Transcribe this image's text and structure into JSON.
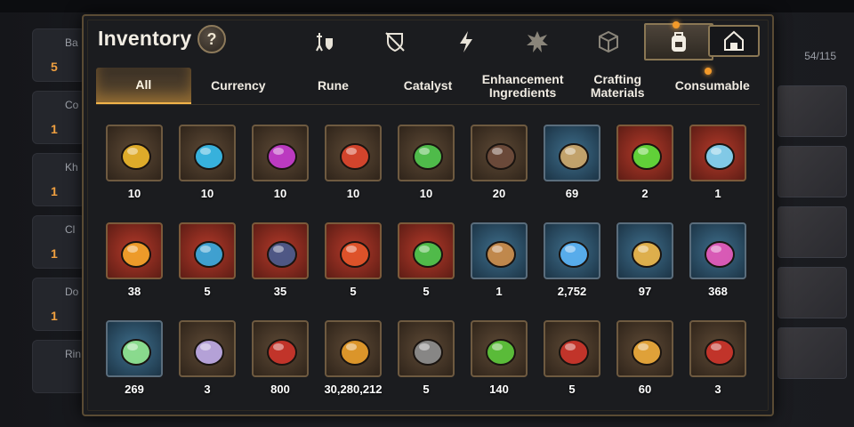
{
  "header": {
    "title": "Inventory",
    "help_label": "?"
  },
  "background": {
    "counter": "54/115",
    "rows": [
      {
        "label": "Ba",
        "num": "5"
      },
      {
        "label": "Co",
        "num": "1"
      },
      {
        "label": "Kh",
        "num": "1"
      },
      {
        "label": "Cl",
        "num": "1"
      },
      {
        "label": "Do",
        "num": "1"
      },
      {
        "label": "Rin",
        "num": ""
      }
    ]
  },
  "category_tabs": [
    {
      "icon": "knight-shield-icon"
    },
    {
      "icon": "broken-shield-icon"
    },
    {
      "icon": "lightning-icon"
    },
    {
      "icon": "burst-icon"
    },
    {
      "icon": "cube-icon"
    },
    {
      "icon": "backpack-icon",
      "active": true
    }
  ],
  "filter_tabs": [
    {
      "label": "All",
      "active": true
    },
    {
      "label": "Currency"
    },
    {
      "label": "Rune"
    },
    {
      "label": "Catalyst"
    },
    {
      "label": "Enhancement Ingredients"
    },
    {
      "label": "Crafting Materials"
    },
    {
      "label": "Consumable"
    }
  ],
  "items": [
    {
      "icon": "yellow-rune-icon",
      "count": "10",
      "color": "#e6b12a",
      "bg": "brown"
    },
    {
      "icon": "blue-rune-icon",
      "count": "10",
      "color": "#36b7e6",
      "bg": "brown"
    },
    {
      "icon": "purple-rune-icon",
      "count": "10",
      "color": "#c13ac8",
      "bg": "brown"
    },
    {
      "icon": "red-rune-icon",
      "count": "10",
      "color": "#d9452c",
      "bg": "brown"
    },
    {
      "icon": "green-rune-icon",
      "count": "10",
      "color": "#4fc24c",
      "bg": "brown"
    },
    {
      "icon": "beak-icon",
      "count": "20",
      "color": "#6b4a3a",
      "bg": "brown"
    },
    {
      "icon": "feather-icon",
      "count": "69",
      "color": "#c9a56a",
      "bg": "blue"
    },
    {
      "icon": "green-cauldron-icon",
      "count": "2",
      "color": "#5ed93a",
      "bg": "red"
    },
    {
      "icon": "triangle-crystal-icon",
      "count": "1",
      "color": "#7fd2f0",
      "bg": "red"
    },
    {
      "icon": "amber-shard-icon",
      "count": "38",
      "color": "#f0a02a",
      "bg": "red"
    },
    {
      "icon": "tide-amulet-icon",
      "count": "5",
      "color": "#3aa6d9",
      "bg": "red"
    },
    {
      "icon": "wave-disc-icon",
      "count": "35",
      "color": "#4a5a8a",
      "bg": "red"
    },
    {
      "icon": "flame-amulet-icon",
      "count": "5",
      "color": "#e0542a",
      "bg": "red"
    },
    {
      "icon": "tree-amulet-icon",
      "count": "5",
      "color": "#4cc24c",
      "bg": "red"
    },
    {
      "icon": "staff-ornament-icon",
      "count": "1",
      "color": "#c78a4a",
      "bg": "blue"
    },
    {
      "icon": "blue-gem-icon",
      "count": "2,752",
      "color": "#5ab0f0",
      "bg": "blue"
    },
    {
      "icon": "star-amulet-icon",
      "count": "97",
      "color": "#e7b34a",
      "bg": "blue"
    },
    {
      "icon": "pink-crystal-icon",
      "count": "368",
      "color": "#e05ab8",
      "bg": "blue"
    },
    {
      "icon": "leaf-icon",
      "count": "269",
      "color": "#8ee08e",
      "bg": "blue"
    },
    {
      "icon": "spirit-charm-icon",
      "count": "3",
      "color": "#b9a7e0",
      "bg": "brown"
    },
    {
      "icon": "red-leaf-pair-icon",
      "count": "800",
      "color": "#c7342a",
      "bg": "brown"
    },
    {
      "icon": "gold-coin-icon",
      "count": "30,280,212",
      "color": "#e39a2a",
      "bg": "brown"
    },
    {
      "icon": "stone-block-icon",
      "count": "5",
      "color": "#8a8a8a",
      "bg": "brown"
    },
    {
      "icon": "green-heart-icon",
      "count": "140",
      "color": "#5bc23a",
      "bg": "brown"
    },
    {
      "icon": "red-banner-icon",
      "count": "5",
      "color": "#c7342a",
      "bg": "brown"
    },
    {
      "icon": "gold-medal-icon",
      "count": "60",
      "color": "#e7a63a",
      "bg": "brown"
    },
    {
      "icon": "red-badge-icon",
      "count": "3",
      "color": "#c7342a",
      "bg": "brown"
    }
  ]
}
